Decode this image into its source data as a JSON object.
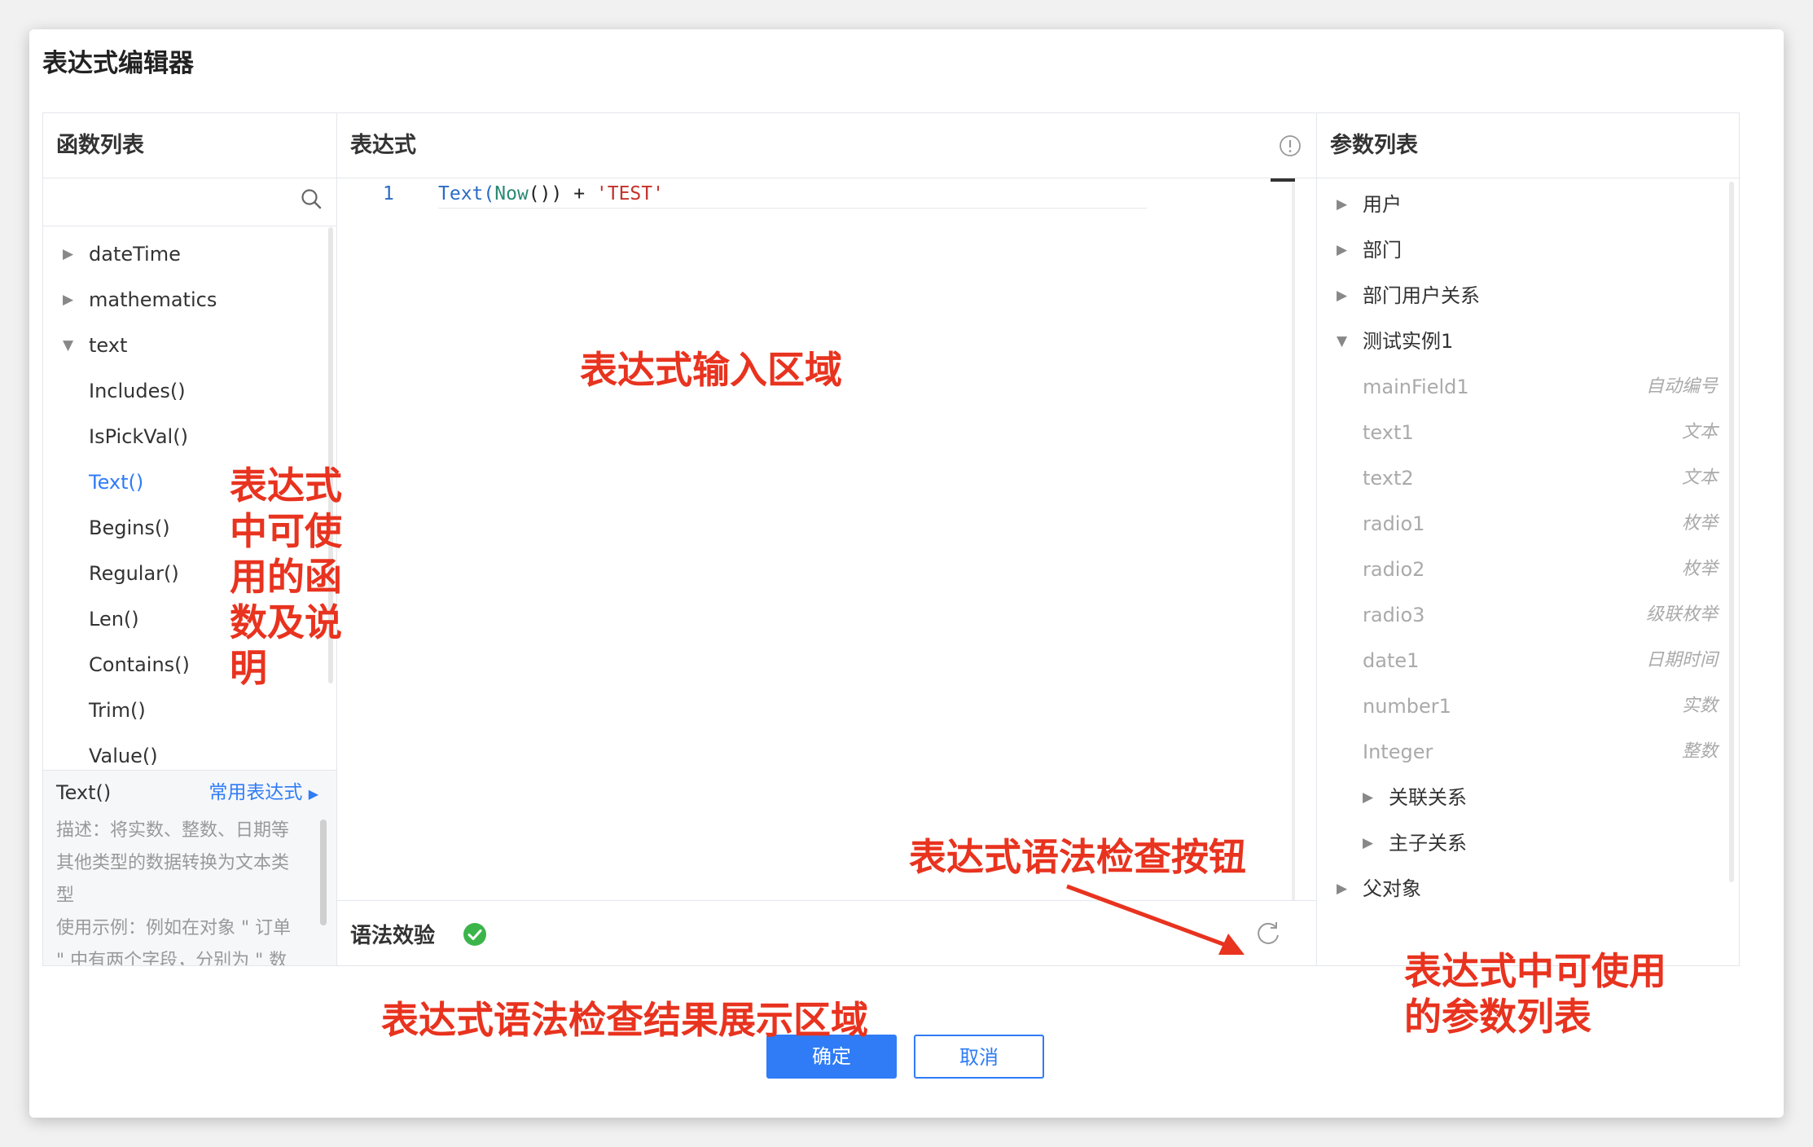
{
  "dialog": {
    "title": "表达式编辑器",
    "confirm": "确定",
    "cancel": "取消"
  },
  "functions": {
    "header": "函数列表",
    "categories": [
      {
        "label": "dateTime",
        "arrow": "▶"
      },
      {
        "label": "mathematics",
        "arrow": "▶"
      },
      {
        "label": "text",
        "arrow": "▼"
      }
    ],
    "items": [
      "Includes()",
      "IsPickVal()",
      "Text()",
      "Begins()",
      "Regular()",
      "Len()",
      "Contains()",
      "Trim()",
      "Value()"
    ],
    "selected": "Text()",
    "detail": {
      "name": "Text()",
      "link": "常用表达式",
      "desc1": "描述：将实数、整数、日期等",
      "desc2": "其他类型的数据转换为文本类",
      "desc3": "型",
      "example": "使用示例：例如在对象 \" 订单",
      "example2": "\" 中有两个字段，分别为 \" 数"
    }
  },
  "expression": {
    "header": "表达式",
    "line_no": "1",
    "code": {
      "p1": "Text(",
      "p2": "Now",
      "p3": "())",
      "p4": " + ",
      "p5": "'TEST'"
    },
    "check_label": "语法效验"
  },
  "params": {
    "header": "参数列表",
    "roots": [
      {
        "label": "用户",
        "arrow": "▶"
      },
      {
        "label": "部门",
        "arrow": "▶"
      },
      {
        "label": "部门用户关系",
        "arrow": "▶"
      },
      {
        "label": "测试实例1",
        "arrow": "▼"
      }
    ],
    "fields": [
      {
        "name": "mainField1",
        "type": "自动编号"
      },
      {
        "name": "text1",
        "type": "文本"
      },
      {
        "name": "text2",
        "type": "文本"
      },
      {
        "name": "radio1",
        "type": "枚举"
      },
      {
        "name": "radio2",
        "type": "枚举"
      },
      {
        "name": "radio3",
        "type": "级联枚举"
      },
      {
        "name": "date1",
        "type": "日期时间"
      },
      {
        "name": "number1",
        "type": "实数"
      },
      {
        "name": "Integer",
        "type": "整数"
      }
    ],
    "subs": [
      {
        "label": "关联关系",
        "arrow": "▶"
      },
      {
        "label": "主子关系",
        "arrow": "▶"
      }
    ],
    "parent": {
      "label": "父对象",
      "arrow": "▶"
    }
  },
  "annotations": {
    "input_area": "表达式输入区域",
    "functions_note_1": "表达式",
    "functions_note_2": "中可使",
    "functions_note_3": "用的函",
    "functions_note_4": "数及说",
    "functions_note_5": "明",
    "check_button": "表达式语法检查按钮",
    "check_result": "表达式语法检查结果展示区域",
    "params_note_1": "表达式中可使用",
    "params_note_2": "的参数列表"
  },
  "colors": {
    "accent": "#2f7cf6",
    "annotation": "#e8331f",
    "success": "#3bb54a"
  }
}
